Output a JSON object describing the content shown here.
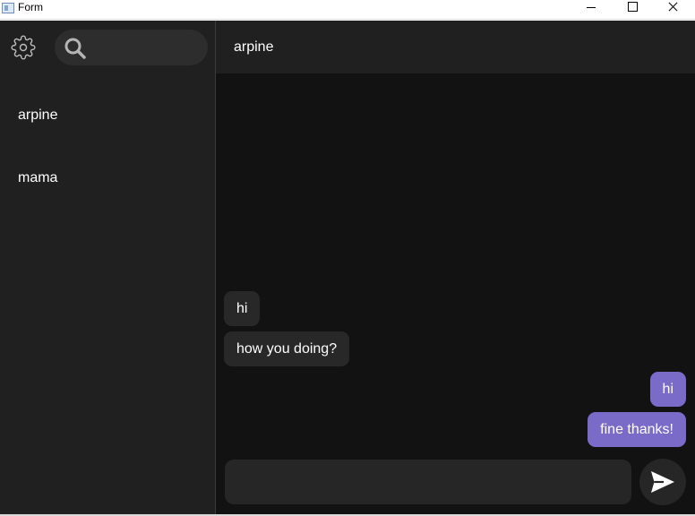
{
  "window": {
    "title": "Form",
    "controls": [
      "minimize",
      "maximize",
      "close"
    ]
  },
  "sidebar": {
    "settings_icon": "gear-icon",
    "search": {
      "icon": "search-icon",
      "value": "",
      "placeholder": ""
    },
    "contacts": [
      {
        "label": "arpine"
      },
      {
        "label": "mama"
      }
    ]
  },
  "chat": {
    "title": "arpine",
    "messages": [
      {
        "direction": "incoming",
        "text": "hi"
      },
      {
        "direction": "incoming",
        "text": "how you doing?"
      },
      {
        "direction": "outgoing",
        "text": "hi"
      },
      {
        "direction": "outgoing",
        "text": "fine thanks!"
      }
    ],
    "input": {
      "value": "",
      "placeholder": ""
    },
    "send_icon": "send-icon"
  },
  "colors": {
    "sidebar_bg": "#202020",
    "chat_bg": "#121212",
    "incoming_bubble": "#282828",
    "outgoing_bubble": "#7a6bc9",
    "text": "#ffffff"
  }
}
